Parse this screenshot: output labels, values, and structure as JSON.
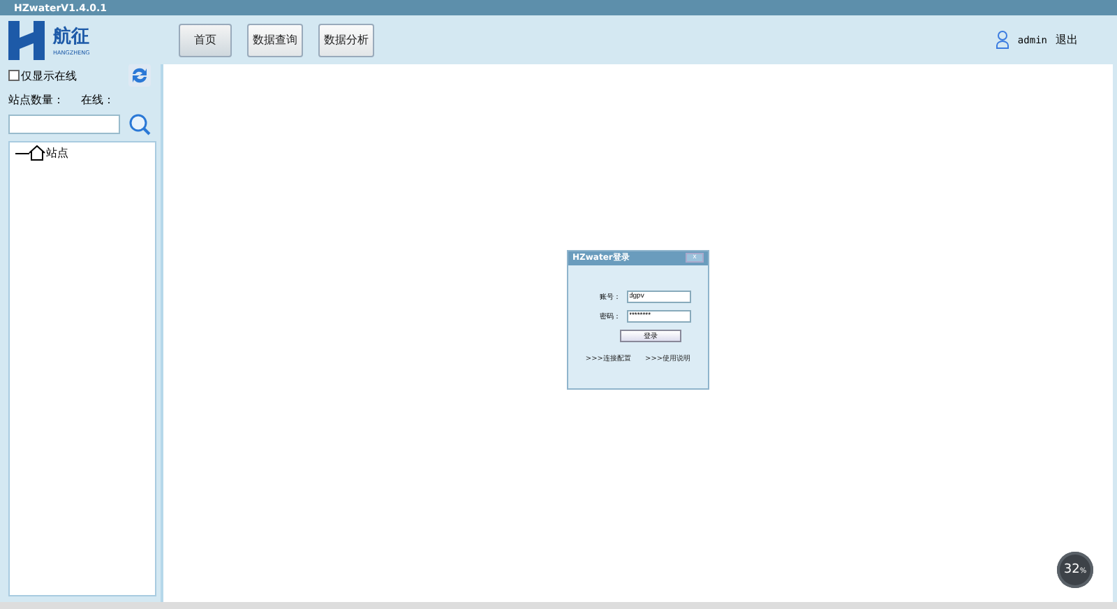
{
  "window": {
    "title": "HZwaterV1.4.0.1"
  },
  "logo": {
    "name": "航征",
    "subtitle": "HANGZHENG"
  },
  "nav": [
    {
      "label": "首页",
      "selected": true
    },
    {
      "label": "数据查询",
      "selected": false
    },
    {
      "label": "数据分析",
      "selected": false
    }
  ],
  "user": {
    "name": "admin",
    "logout": "退出"
  },
  "sidebar": {
    "online_only": {
      "label": "仅显示在线",
      "checked": false
    },
    "station_count_label": "站点数量：",
    "online_label": "在线：",
    "tree": [
      {
        "label": "站点"
      }
    ]
  },
  "login_dialog": {
    "title": "HZwater登录",
    "close": "x",
    "fields": [
      {
        "label": "账号：",
        "value": "dgpv"
      },
      {
        "label": "密码：",
        "value": "********"
      }
    ],
    "submit": "登录",
    "links": [
      ">>>连接配置",
      ">>>使用说明"
    ]
  },
  "memory_widget": {
    "reading": "32",
    "unit": "%"
  }
}
